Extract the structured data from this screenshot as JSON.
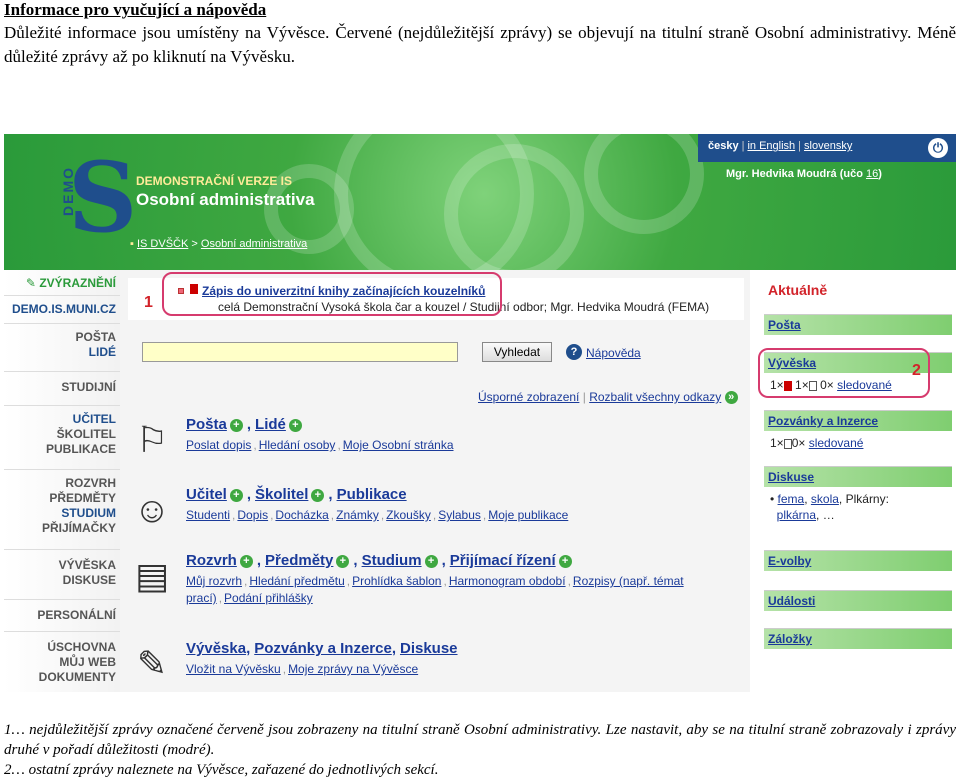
{
  "doc": {
    "title": "Informace pro vyučující a nápověda",
    "intro": "Důležité informace jsou umístěny na Vývěsce. Červené (nejdůležitější zprávy) se objevují na titulní straně Osobní administrativy. Méně důležité zprávy až po kliknutí na Vývěsku.",
    "foot1": "1… nejdůležitější zprávy označené červeně jsou zobrazeny na titulní straně Osobní administrativy. Lze nastavit, aby se na titulní straně zobrazovaly i zprávy druhé v pořadí důležitosti (modré).",
    "foot2": "2… ostatní zprávy naleznete na Vývěsce, zařazené do jednotlivých sekcí."
  },
  "header": {
    "logo_letters": "DEMO",
    "logo_s": "S",
    "demo_label": "DEMONSTRAČNÍ VERZE IS",
    "app_title": "Osobní administrativa",
    "breadcrumb_root": "IS DVŠČK",
    "breadcrumb_sep": ">",
    "breadcrumb_current": "Osobní administrativa",
    "lang_current": "česky",
    "lang_en": "in English",
    "lang_sk": "slovensky",
    "power_glyph": "⏻",
    "user_text": "Mgr. Hedvika Moudrá (učo",
    "user_uco": "16",
    "user_close": ")"
  },
  "nav": {
    "highlights": "ZVÝRAZNĚNÍ",
    "site": "DEMO.IS.MUNI.CZ",
    "posta": "POŠTA",
    "lide": "LIDÉ",
    "studijni": "STUDIJNÍ",
    "ucitel": "UČITEL",
    "skolitel": "ŠKOLITEL",
    "publikace": "PUBLIKACE",
    "rozvrh": "ROZVRH",
    "predmety": "PŘEDMĚTY",
    "studium": "STUDIUM",
    "prijimacky": "PŘIJÍMAČKY",
    "vyveska": "VÝVĚSKA",
    "diskuse": "DISKUSE",
    "personalni": "PERSONÁLNÍ",
    "uschovna": "ÚSCHOVNA",
    "mujweb": "MŮJ WEB",
    "dokumenty": "DOKUMENTY"
  },
  "notice": {
    "marker": "1",
    "link": "Zápis do univerzitní knihy začínajících kouzelníků",
    "sub": "celá Demonstrační Vysoká škola čar a kouzel / Studijní odbor; Mgr. Hedvika Moudrá (FEMA)"
  },
  "search": {
    "button": "Vyhledat",
    "help_glyph": "?",
    "help": "Nápověda",
    "simple_view": "Úsporné zobrazení",
    "view_sep": "|",
    "expand_all": "Rozbalit všechny odkazy"
  },
  "sections": [
    {
      "icon": "⚐",
      "heads": [
        "Pošta",
        "Lidé"
      ],
      "links": [
        "Poslat dopis",
        "Hledání osoby",
        "Moje Osobní stránka"
      ]
    },
    {
      "icon": "☺",
      "heads": [
        "Učitel",
        "Školitel",
        "Publikace"
      ],
      "links": [
        "Studenti",
        "Dopis",
        "Docházka",
        "Známky",
        "Zkoušky",
        "Sylabus",
        "Moje publikace"
      ]
    },
    {
      "icon": "▤",
      "heads": [
        "Rozvrh",
        "Předměty",
        "Studium",
        "Přijímací řízení"
      ],
      "links": [
        "Můj rozvrh",
        "Hledání předmětu",
        "Prohlídka šablon",
        "Harmonogram období",
        "Rozpisy (např. témat prací)",
        "Podání přihlášky"
      ]
    },
    {
      "icon": "✎",
      "heads": [
        "Vývěska",
        "Pozvánky a Inzerce",
        "Diskuse"
      ],
      "links": [
        "Vložit na Vývěsku",
        "Moje zprávy na Vývěsce"
      ]
    }
  ],
  "right": {
    "title": "Aktuálně",
    "posta": "Pošta",
    "vyveska": "Vývěska",
    "vyveska_count_red": "1×",
    "vyveska_count_doc": "1×",
    "vyveska_count_zero": "0×",
    "followed": "sledované",
    "marker": "2",
    "invites": "Pozvánky a Inzerce",
    "invites_count1": "1×",
    "invites_count0": "0×",
    "diskuse": "Diskuse",
    "disc_bullet": "•",
    "disc_a": "fema",
    "disc_b": "skola",
    "disc_c": "Plkárny:",
    "disc_d": "plkárna",
    "disc_more": "…",
    "evolby": "E-volby",
    "udalosti": "Události",
    "zalozky": "Záložky"
  }
}
